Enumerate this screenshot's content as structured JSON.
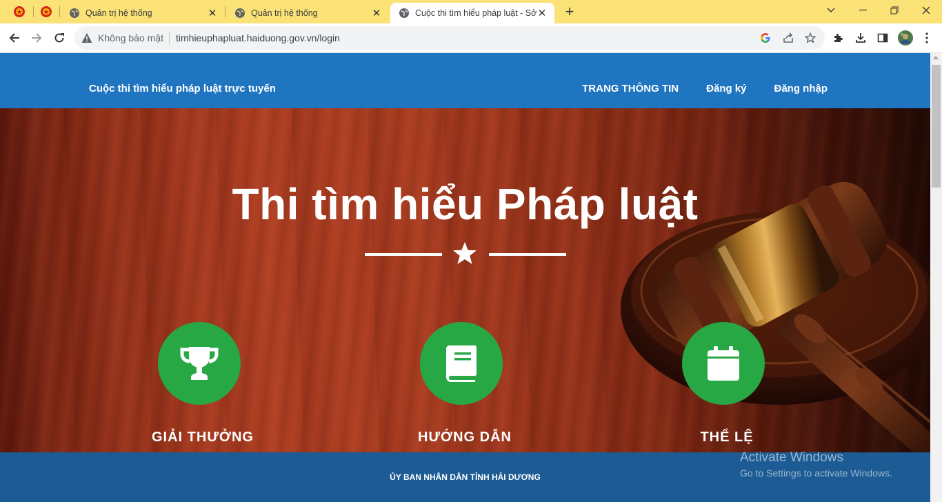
{
  "browser": {
    "tabs": [
      {
        "title": "Quản trị hệ thống"
      },
      {
        "title": "Quản trị hệ thống"
      },
      {
        "title": "Cuộc thi tìm hiểu pháp luật - Sở t"
      }
    ],
    "address": {
      "security_label": "Không bảo mật",
      "url": "timhieuphapluat.haiduong.gov.vn/login"
    }
  },
  "site": {
    "brand": "Cuộc thi tìm hiểu pháp luật trực tuyến",
    "nav": {
      "info": "TRANG THÔNG TIN",
      "register": "Đăng ký",
      "login": "Đăng nhập"
    },
    "hero_title": "Thi tìm hiểu Pháp luật",
    "features": [
      {
        "label": "GIẢI THƯỞNG",
        "icon": "trophy-icon"
      },
      {
        "label": "HƯỚNG DẪN",
        "icon": "book-icon"
      },
      {
        "label": "THỂ LỆ",
        "icon": "calendar-icon"
      }
    ],
    "footer": "ỦY BAN NHÂN DÂN TỈNH HẢI DƯƠNG"
  },
  "os_watermark": {
    "line1": "Activate Windows",
    "line2": "Go to Settings to activate Windows."
  },
  "colors": {
    "tabstrip": "#fbe277",
    "nav": "#2075c0",
    "feature": "#27a844",
    "footer": "#1c5b93"
  }
}
